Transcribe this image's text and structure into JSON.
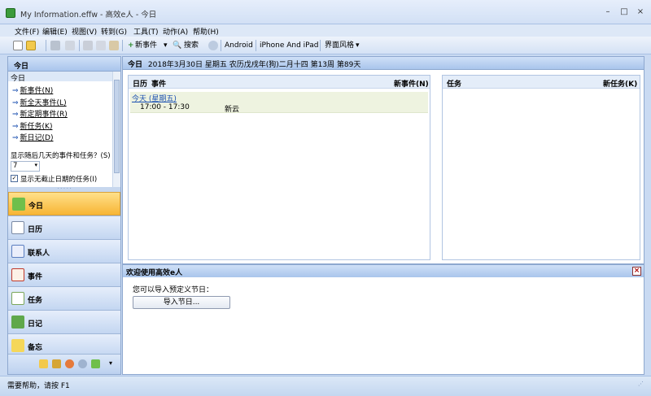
{
  "window": {
    "title": "My Information.effw - 高效e人 - 今日",
    "minimize": "–",
    "maximize": "□",
    "close": "×"
  },
  "menu": [
    "文件(F)",
    "编辑(E)",
    "视图(V)",
    "转到(G)",
    "工具(T)",
    "动作(A)",
    "帮助(H)"
  ],
  "toolbar": {
    "new_event": "新事件",
    "search": "搜索",
    "android": "Android",
    "iphone": "iPhone And iPad",
    "theme": "界面风格"
  },
  "left": {
    "header": "今日",
    "subheader": "今日",
    "links": [
      "新事件(N)",
      "新全天事件(L)",
      "新定期事件(R)",
      "新任务(K)",
      "新日记(D)"
    ],
    "days_label": "显示随后几天的事件和任务？(S)",
    "days_value": "7",
    "show_nodue": "显示无截止日期的任务(I)",
    "nav": [
      "今日",
      "日历",
      "联系人",
      "事件",
      "任务",
      "日记",
      "备忘"
    ]
  },
  "today": {
    "header_title": "今日",
    "header_date": "2018年3月30日 星期五 农历戊戌年(狗)二月十四 第13周 第89天",
    "calendar_tab": "日历",
    "events_tab": "事件",
    "new_event_link": "新事件(N)",
    "tasks_tab": "任务",
    "new_task_link": "新任务(K)",
    "day_heading": "今天 (星期五)",
    "event_time": "17:00 - 17:30",
    "event_title": "新云"
  },
  "welcome": {
    "title": "欢迎使用高效e人",
    "prompt": "您可以导入预定义节日：",
    "import_button": "导入节日..."
  },
  "status": {
    "text": "需要帮助，请按 F1"
  }
}
